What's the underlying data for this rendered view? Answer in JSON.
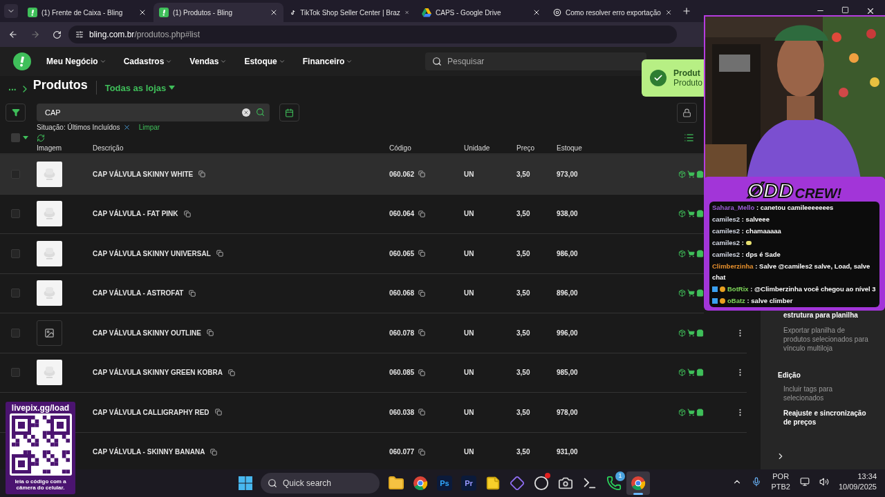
{
  "browser": {
    "tabs": [
      {
        "title": "(1) Frente de Caixa - Bling",
        "kind": "bling",
        "selected": false
      },
      {
        "title": "(1) Produtos - Bling",
        "kind": "bling",
        "selected": true
      },
      {
        "title": "TikTok Shop Seller Center | Braz",
        "kind": "tiktok",
        "selected": false
      },
      {
        "title": "CAPS - Google Drive",
        "kind": "drive",
        "selected": false
      },
      {
        "title": "Como resolver erro exportação",
        "kind": "gpt",
        "selected": false
      }
    ],
    "url_host": "bling.com.br",
    "url_path": "/produtos.php#list"
  },
  "nav": {
    "items": [
      "Meu Negócio",
      "Cadastros",
      "Vendas",
      "Estoque",
      "Financeiro"
    ],
    "search_placeholder": "Pesquisar"
  },
  "toast": {
    "title": "Produt",
    "text": "Produto"
  },
  "page": {
    "select_all_checked": false,
    "breadcrumb": "...",
    "title": "Produtos",
    "store_filter": "Todas as lojas",
    "search_value": "CAP",
    "filter_chip": "Situação: Últimos Incluídos",
    "clear_link": "Limpar"
  },
  "table": {
    "columns": [
      "Imagem",
      "Descrição",
      "Código",
      "Unidade",
      "Preço",
      "Estoque"
    ],
    "rows": [
      {
        "checked": false,
        "kind": "picture",
        "description": "CAP VÁLVULA SKINNY WHITE",
        "code": "060.062",
        "unit": "UN",
        "price": "3,50",
        "stock": "973,00",
        "highlighted": true,
        "actions": true,
        "menu": false
      },
      {
        "checked": false,
        "kind": "picture",
        "description": "CAP VÁLVULA - FAT PINK",
        "code": "060.064",
        "unit": "UN",
        "price": "3,50",
        "stock": "938,00",
        "highlighted": false,
        "actions": true,
        "menu": false
      },
      {
        "checked": false,
        "kind": "picture",
        "description": "CAP VÁLVULA SKINNY UNIVERSAL",
        "code": "060.065",
        "unit": "UN",
        "price": "3,50",
        "stock": "986,00",
        "highlighted": false,
        "actions": true,
        "menu": false
      },
      {
        "checked": false,
        "kind": "picture",
        "description": "CAP VÁLVULA - ASTROFAT",
        "code": "060.068",
        "unit": "UN",
        "price": "3,50",
        "stock": "896,00",
        "highlighted": false,
        "actions": true,
        "menu": false
      },
      {
        "checked": false,
        "kind": "placeholder",
        "description": "CAP VÁLVULA SKINNY OUTLINE",
        "code": "060.078",
        "unit": "UN",
        "price": "3,50",
        "stock": "996,00",
        "highlighted": false,
        "actions": true,
        "menu": true
      },
      {
        "checked": false,
        "kind": "picture",
        "description": "CAP VÁLVULA SKINNY GREEN KOBRA",
        "code": "060.085",
        "unit": "UN",
        "price": "3,50",
        "stock": "985,00",
        "highlighted": false,
        "actions": true,
        "menu": true
      },
      {
        "description": "CAP VÁLVULA CALLIGRAPHY RED",
        "code": "060.038",
        "unit": "UN",
        "price": "3,50",
        "stock": "978,00",
        "highlighted": false,
        "actions": true,
        "menu": true
      },
      {
        "description": "CAP VÁLVULA - SKINNY BANANA",
        "code": "060.077",
        "unit": "UN",
        "price": "3,50",
        "stock": "931,00",
        "highlighted": false,
        "actions": false,
        "menu": false
      }
    ]
  },
  "sidebar": {
    "items": [
      {
        "kind": "action",
        "text": "estrutura para planilha",
        "strong": true
      },
      {
        "kind": "action",
        "text": "Exportar planilha de produtos selecionados para vínculo multiloja",
        "strong": false
      },
      {
        "kind": "heading",
        "text": "Edição"
      },
      {
        "kind": "action",
        "text": "Incluir tags para selecionados",
        "strong": false
      },
      {
        "kind": "action",
        "text": "Reajuste e sincronização de preços",
        "strong": true
      }
    ]
  },
  "stream": {
    "logo_left": "ØDD",
    "logo_right": "CREW!",
    "chat": [
      {
        "user": "Sahara_Mello",
        "color": "#9b5fd6",
        "text": ": canetou camileeeeeees",
        "kind": "text",
        "badges": false
      },
      {
        "user": "camiles2",
        "color": "#d5dae6",
        "text": ": salveee",
        "kind": "text",
        "badges": false
      },
      {
        "user": "camiles2",
        "color": "#d5dae6",
        "text": ": chamaaaaa",
        "kind": "text",
        "badges": false
      },
      {
        "user": "camiles2",
        "color": "#d5dae6",
        "text": " :",
        "kind": "emote",
        "badges": false
      },
      {
        "user": "camiles2",
        "color": "#d5dae6",
        "text": ": dps é Sade",
        "kind": "text",
        "badges": false
      },
      {
        "user": "Climberzinha",
        "color": "#e8912d",
        "text": ": Salve @camiles2 salve, Load, salve chat",
        "kind": "text",
        "badges": false
      },
      {
        "user": "BotRix",
        "color": "#7fd85a",
        "text": ": @Climberzinha você chegou ao nível 3",
        "kind": "text",
        "badges": true
      },
      {
        "user": "oBatz",
        "color": "#7fd85a",
        "text": ": salve climber",
        "kind": "text",
        "badges": true
      }
    ],
    "qr_title": "livepix.gg/load",
    "qr_caption": "leia o código com a câmera do celular."
  },
  "taskbar": {
    "search_placeholder": "Quick search",
    "apps": [
      {
        "kind": "folder"
      },
      {
        "kind": "chrome"
      },
      {
        "kind": "text",
        "label": "Ps",
        "color": "#31a8ff"
      },
      {
        "kind": "text",
        "label": "Pr",
        "color": "#9999ff"
      },
      {
        "kind": "notes"
      },
      {
        "kind": "diamond"
      },
      {
        "kind": "obs",
        "badge_dot": true
      },
      {
        "kind": "camera"
      },
      {
        "kind": "terminal"
      },
      {
        "kind": "whatsapp",
        "badge": "1"
      },
      {
        "kind": "chrome",
        "active": true
      }
    ],
    "language": "POR",
    "layout": "PTB2",
    "time": "13:34",
    "date": "10/09/2025"
  }
}
